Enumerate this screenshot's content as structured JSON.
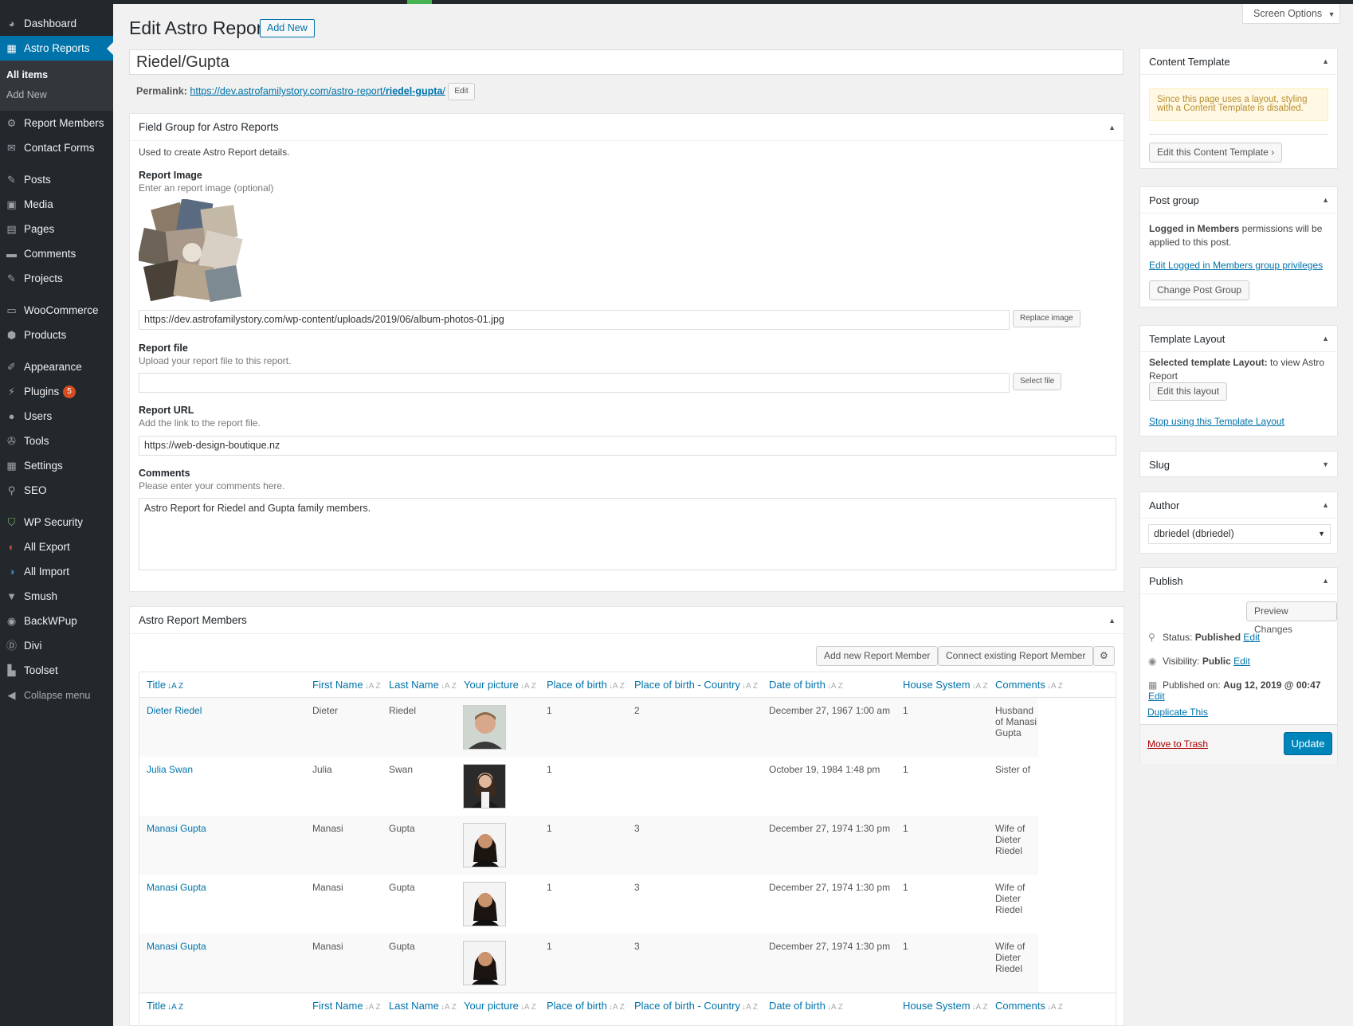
{
  "sidebar": {
    "items": [
      {
        "label": "Dashboard",
        "icon": "dashboard-icon"
      },
      {
        "label": "Astro Reports",
        "icon": "report-icon"
      },
      {
        "label": "Report Members",
        "icon": "members-icon"
      },
      {
        "label": "Contact Forms",
        "icon": "mail-icon"
      },
      {
        "label": "Posts",
        "icon": "pin-icon"
      },
      {
        "label": "Media",
        "icon": "media-icon"
      },
      {
        "label": "Pages",
        "icon": "pages-icon"
      },
      {
        "label": "Comments",
        "icon": "comment-icon"
      },
      {
        "label": "Projects",
        "icon": "pin-icon"
      },
      {
        "label": "WooCommerce",
        "icon": "woocommerce-icon"
      },
      {
        "label": "Products",
        "icon": "products-icon"
      },
      {
        "label": "Appearance",
        "icon": "brush-icon"
      },
      {
        "label": "Plugins",
        "icon": "plugin-icon",
        "badge": "5"
      },
      {
        "label": "Users",
        "icon": "user-icon"
      },
      {
        "label": "Tools",
        "icon": "wrench-icon"
      },
      {
        "label": "Settings",
        "icon": "settings-icon"
      },
      {
        "label": "SEO",
        "icon": "search-icon"
      },
      {
        "label": "WP Security",
        "icon": "shield-icon"
      },
      {
        "label": "All Export",
        "icon": "export-icon"
      },
      {
        "label": "All Import",
        "icon": "import-icon"
      },
      {
        "label": "Smush",
        "icon": "smush-icon"
      },
      {
        "label": "BackWPup",
        "icon": "backup-icon"
      },
      {
        "label": "Divi",
        "icon": "divi-icon"
      },
      {
        "label": "Toolset",
        "icon": "toolset-icon"
      }
    ],
    "submenu": [
      "All items",
      "Add New"
    ],
    "collapse": "Collapse menu"
  },
  "header": {
    "screen_options": "Screen Options",
    "title": "Edit Astro Report",
    "add_new": "Add New"
  },
  "post": {
    "title": "Riedel/Gupta",
    "permalink_label": "Permalink:",
    "permalink_base": "https://dev.astrofamilystory.com/astro-report/",
    "permalink_slug": "riedel-gupta",
    "permalink_end": "/",
    "permalink_edit": "Edit"
  },
  "field_group": {
    "title": "Field Group for Astro Reports",
    "description": "Used to create Astro Report details.",
    "report_image_label": "Report Image",
    "report_image_desc": "Enter an report image (optional)",
    "report_image_url": "https://dev.astrofamilystory.com/wp-content/uploads/2019/06/album-photos-01.jpg",
    "replace_image": "Replace image",
    "report_file_label": "Report file",
    "report_file_desc": "Upload your report file to this report.",
    "report_file_value": "",
    "select_file": "Select file",
    "report_url_label": "Report URL",
    "report_url_desc": "Add the link to the report file.",
    "report_url_value": "https://web-design-boutique.nz",
    "comments_label": "Comments",
    "comments_desc": "Please enter your comments here.",
    "comments_value": "Astro Report for Riedel and Gupta family members."
  },
  "members": {
    "title": "Astro Report Members",
    "add_new": "Add new Report Member",
    "connect": "Connect existing Report Member",
    "columns": [
      "Title",
      "First Name",
      "Last Name",
      "Your picture",
      "Place of birth",
      "Place of birth - Country",
      "Date of birth",
      "House System",
      "Comments"
    ],
    "rows": [
      {
        "title": "Dieter Riedel",
        "first": "Dieter",
        "last": "Riedel",
        "pob": "1",
        "country": "2",
        "dob": "December 27, 1967 1:00 am",
        "house": "1",
        "comments": "Husband of Manasi Gupta"
      },
      {
        "title": "Julia Swan",
        "first": "Julia",
        "last": "Swan",
        "pob": "1",
        "country": "",
        "dob": "October 19, 1984 1:48 pm",
        "house": "1",
        "comments": "Sister of"
      },
      {
        "title": "Manasi Gupta",
        "first": "Manasi",
        "last": "Gupta",
        "pob": "1",
        "country": "3",
        "dob": "December 27, 1974 1:30 pm",
        "house": "1",
        "comments": "Wife of Dieter Riedel"
      },
      {
        "title": "Manasi Gupta",
        "first": "Manasi",
        "last": "Gupta",
        "pob": "1",
        "country": "3",
        "dob": "December 27, 1974 1:30 pm",
        "house": "1",
        "comments": "Wife of Dieter Riedel"
      },
      {
        "title": "Manasi Gupta",
        "first": "Manasi",
        "last": "Gupta",
        "pob": "1",
        "country": "3",
        "dob": "December 27, 1974 1:30 pm",
        "house": "1",
        "comments": "Wife of Dieter Riedel"
      }
    ]
  },
  "right": {
    "content_template": {
      "title": "Content Template",
      "notice": "Since this page uses a layout, styling with a Content Template is disabled.",
      "edit_btn": "Edit this Content Template"
    },
    "post_group": {
      "title": "Post group",
      "text_bold": "Logged in Members",
      "text_rest": " permissions will be applied to this post.",
      "edit_link": "Edit Logged in Members group privileges",
      "change_btn": "Change Post Group"
    },
    "template_layout": {
      "title": "Template Layout",
      "selected_bold": "Selected template Layout:",
      "selected_rest": " to view Astro Report",
      "edit_btn": "Edit this layout",
      "stop_link": "Stop using this Template Layout"
    },
    "slug": {
      "title": "Slug"
    },
    "author": {
      "title": "Author",
      "value": "dbriedel (dbriedel)"
    },
    "publish": {
      "title": "Publish",
      "preview": "Preview Changes",
      "status_label": "Status:",
      "status_value": "Published",
      "visibility_label": "Visibility:",
      "visibility_value": "Public",
      "published_label": "Published on:",
      "published_value": "Aug 12, 2019 @ 00:47",
      "edit": "Edit",
      "duplicate": "Duplicate This",
      "trash": "Move to Trash",
      "update": "Update"
    }
  }
}
